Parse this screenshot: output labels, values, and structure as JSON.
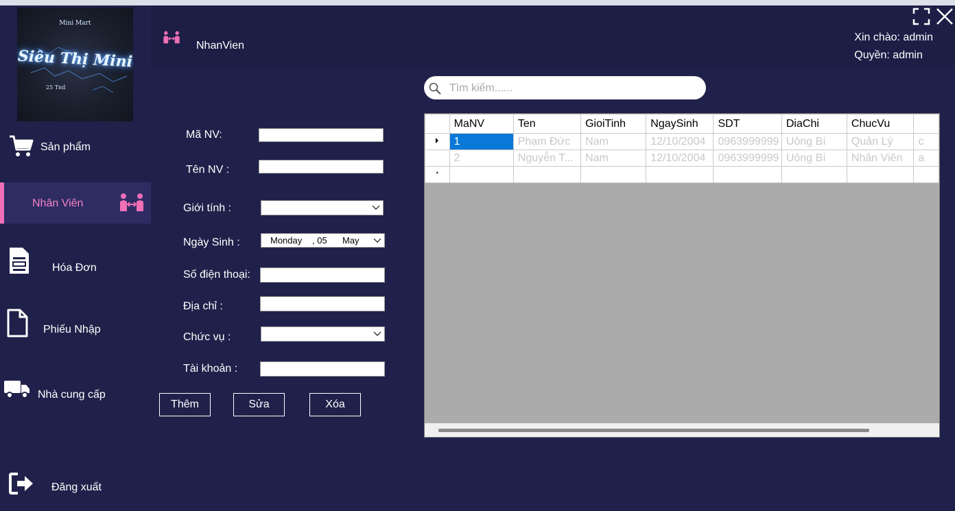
{
  "sidebar": {
    "logo": {
      "line1": "Mini Mart",
      "line2": "Siêu Thị Mini",
      "line3": "25 Tnd"
    },
    "items": [
      {
        "label": "Sản phẩm",
        "icon": "cart-icon",
        "active": false
      },
      {
        "label": "Nhân Viên",
        "icon": "people-icon",
        "active": true
      },
      {
        "label": "Hóa Đơn",
        "icon": "invoice-icon",
        "active": false
      },
      {
        "label": "Phiếu Nhập",
        "icon": "document-icon",
        "active": false
      },
      {
        "label": "Nhà cung cấp",
        "icon": "truck-icon",
        "active": false
      },
      {
        "label": "Đăng xuất",
        "icon": "logout-icon",
        "active": false
      }
    ],
    "accent_color": "#f06fb6"
  },
  "header": {
    "title": "NhanVien",
    "greeting": "Xin chào: admin",
    "role": "Quyền: admin"
  },
  "form": {
    "ma_nv_label": "Mã NV:",
    "ten_nv_label": "Tên NV :",
    "gioi_tinh_label": "Giới tính :",
    "ngay_sinh_label": "Ngày Sinh :",
    "sdt_label": "Số điện thoại:",
    "dia_chi_label": "Địa chỉ :",
    "chuc_vu_label": "Chức vụ :",
    "tai_khoan_label": "Tài khoản :",
    "date_weekday": "Monday",
    "date_day": ", 05",
    "date_month": "May"
  },
  "buttons": {
    "add": "Thêm",
    "edit": "Sửa",
    "delete": "Xóa"
  },
  "search": {
    "placeholder": "Tìm kiếm......"
  },
  "grid": {
    "columns": [
      "MaNV",
      "Ten",
      "GioiTinh",
      "NgaySinh",
      "SDT",
      "DiaChi",
      "ChucVu",
      ""
    ],
    "rows": [
      [
        "1",
        "Phạm Đức",
        "Nam",
        "12/10/2004",
        "0963999999",
        "Uông Bí",
        "Quản Lý",
        "c"
      ],
      [
        "2",
        "Nguyễn T...",
        "Nam",
        "12/10/2004",
        "0963999999",
        "Uông Bí",
        "Nhân Viên",
        "a"
      ]
    ],
    "new_row_marker": "*"
  }
}
